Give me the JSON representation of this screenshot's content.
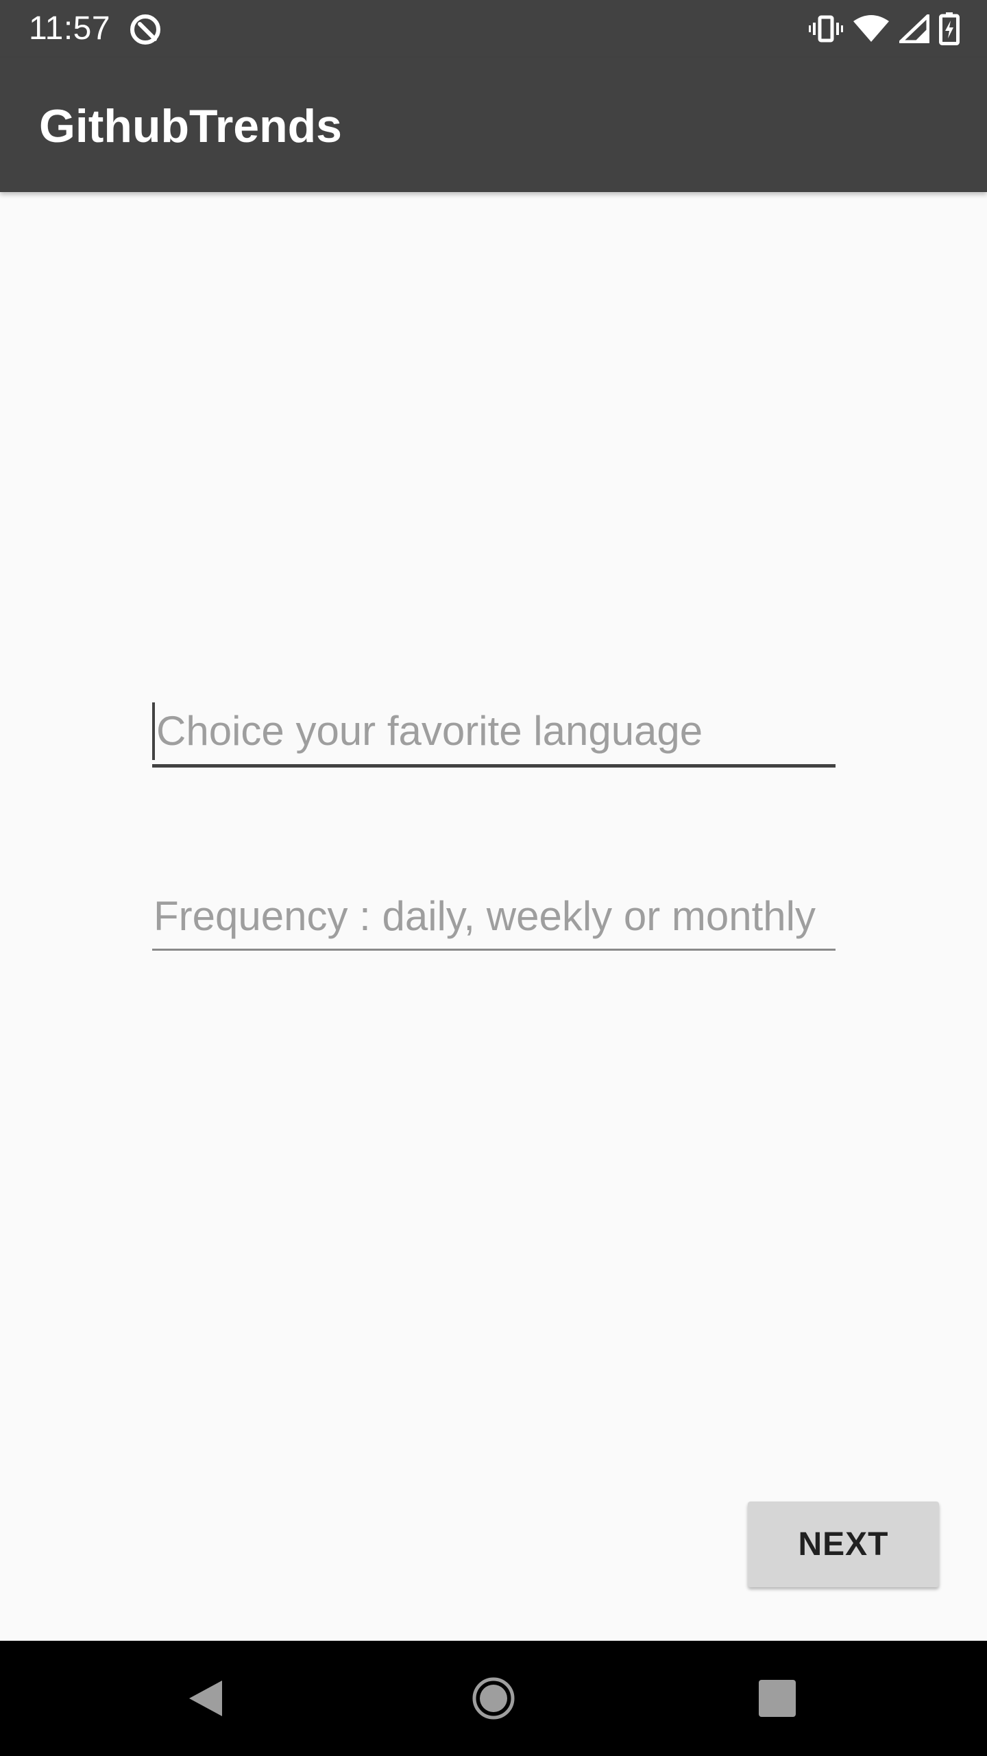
{
  "status_bar": {
    "time": "11:57",
    "left_icon": "data-saver-icon",
    "icons": [
      "vibrate-icon",
      "wifi-icon",
      "cell-signal-icon",
      "battery-charging-icon"
    ]
  },
  "app_bar": {
    "title": "GithubTrends"
  },
  "form": {
    "language_placeholder": "Choice your favorite language",
    "language_value": "",
    "frequency_placeholder": "Frequency : daily, weekly or monthly",
    "frequency_value": ""
  },
  "actions": {
    "next_label": "NEXT"
  },
  "nav_bar": {
    "buttons": [
      "back-icon",
      "home-icon",
      "recents-icon"
    ]
  },
  "colors": {
    "app_bar": "#424242",
    "background": "#fafafa",
    "hint_text": "#9e9e9e",
    "button": "#d6d6d6",
    "nav_bar": "#000000"
  }
}
